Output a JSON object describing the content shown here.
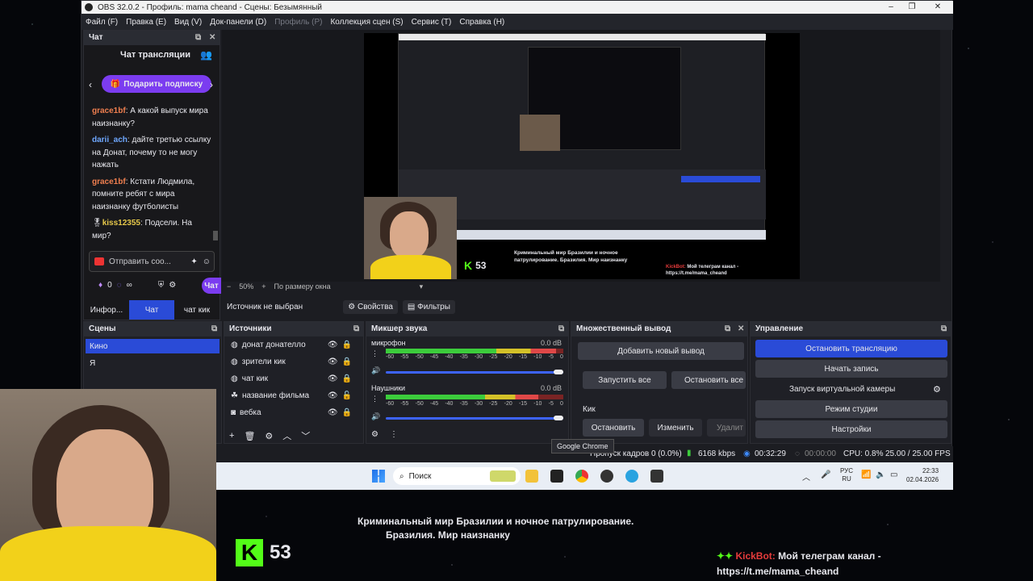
{
  "window": {
    "title": "OBS 32.0.2 - Профиль: mama cheand - Сцены: Безымянный",
    "min": "–",
    "max": "❐",
    "close": "✕"
  },
  "menu": [
    "Файл (F)",
    "Правка (E)",
    "Вид (V)",
    "Док-панели (D)",
    "Профиль (P)",
    "Коллекция сцен (S)",
    "Сервис (T)",
    "Справка (H)"
  ],
  "chat": {
    "dock_title": "Чат",
    "header": "Чат трансляции",
    "gift_button": "Подарить подписку",
    "messages": [
      {
        "user": "grace1bf",
        "user_color": "#f07f4f",
        "text": ": А какой выпуск мира наизнанку?"
      },
      {
        "user": "darii_ach",
        "user_color": "#6fa8ff",
        "text": ": дайте третью ссылку на Донат, почему то не могу нажать"
      },
      {
        "user": "grace1bf",
        "user_color": "#f07f4f",
        "text": ": Кстати Людмила, помните ребят с мира наизнанку футболисты"
      },
      {
        "user": "kiss12355",
        "user_color": "#e6c84a",
        "text": ": Подсели. На мир?"
      }
    ],
    "send_placeholder": "Отправить соо...",
    "points": "0",
    "infinity": "∞",
    "chat_button": "Чат",
    "tabs": [
      "Инфор...",
      "Чат",
      "чат кик"
    ]
  },
  "preview": {
    "zoom": "50%",
    "fit": "По размеру окна",
    "kick_count": "53",
    "overlay_title": "Криминальный мир Бразилии и ночное патрулирование. Бразилия. Мир наизнанку",
    "bot_name": "KickBot:",
    "bot_text": "Мой телеграм канал - https://t.me/mama_cheand"
  },
  "source_bar": {
    "status": "Источник не выбран",
    "properties": "Свойства",
    "filters": "Фильтры"
  },
  "scenes": {
    "title": "Сцены",
    "items": [
      "Кино",
      "Я"
    ]
  },
  "sources": {
    "title": "Источники",
    "items": [
      "донат донателло",
      "зрители кик",
      "чат кик",
      "название фильма",
      "вебка"
    ]
  },
  "mixer": {
    "title": "Микшер звука",
    "channels": [
      {
        "name": "микрофон",
        "db": "0.0 dB",
        "level": 0.96
      },
      {
        "name": "Наушники",
        "db": "0.0 dB",
        "level": 0.86
      }
    ],
    "ticks": [
      "-60",
      "-55",
      "-50",
      "-45",
      "-40",
      "-35",
      "-30",
      "-25",
      "-20",
      "-15",
      "-10",
      "-5",
      "0"
    ]
  },
  "multi": {
    "title": "Множественный вывод",
    "add": "Добавить новый вывод",
    "start_all": "Запустить все",
    "stop_all": "Остановить все",
    "target": "Кик",
    "stop": "Остановить",
    "edit": "Изменить",
    "delete": "Удалит"
  },
  "controls": {
    "title": "Управление",
    "stop_stream": "Остановить трансляцию",
    "start_rec": "Начать запись",
    "virtual_cam": "Запуск виртуальной камеры",
    "studio": "Режим студии",
    "settings": "Настройки"
  },
  "tooltip": "Google Chrome",
  "status": {
    "dropped": "Пропуск кадров 0 (0.0%)",
    "bitrate": "6168 kbps",
    "live": "00:32:29",
    "rec": "00:00:00",
    "cpu": "CPU: 0.8%",
    "fps": "25.00 / 25.00 FPS"
  },
  "taskbar": {
    "search": "Поиск",
    "lang1": "РУС",
    "lang2": "RU",
    "time": "22:33",
    "date": "02.04.2026"
  },
  "stream_overlay": {
    "kick_count": "53",
    "title_line1": "Криминальный мир Бразилии и ночное патрулирование.",
    "title_line2": "Бразилия. Мир наизнанку",
    "bot_name": "KickBot:",
    "bot_text1": "Мой телеграм канал -",
    "bot_text2": "https://t.me/mama_cheand"
  },
  "colors": {
    "accent": "#2a4bd7",
    "kick_green": "#53fc18",
    "purple": "#7b3cf0"
  }
}
